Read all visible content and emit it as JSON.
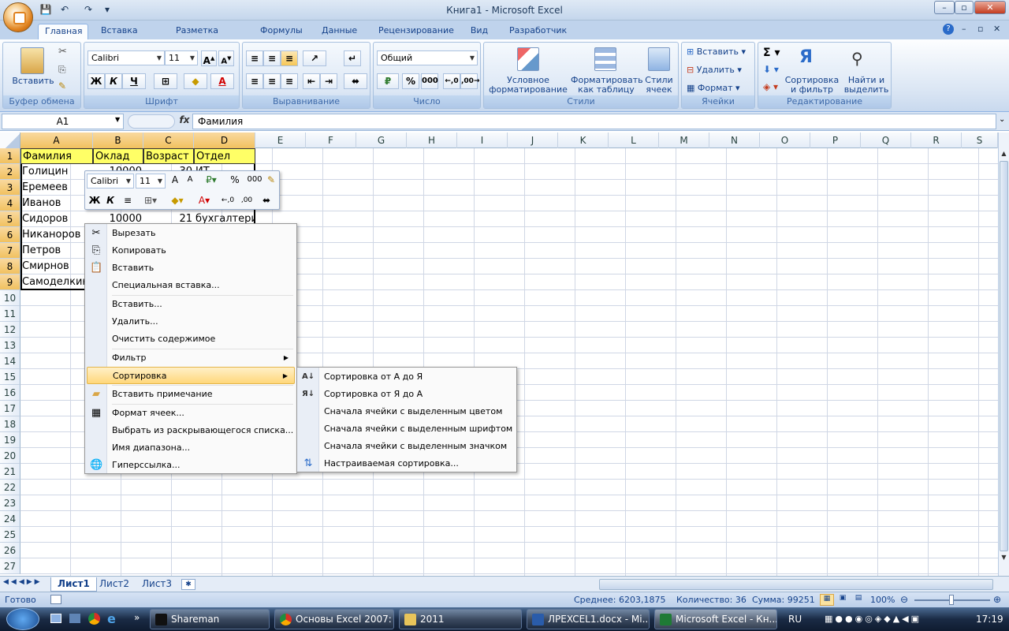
{
  "window": {
    "title": "Книга1 - Microsoft Excel"
  },
  "ribbon": {
    "tabs": [
      "Главная",
      "Вставка",
      "Разметка страницы",
      "Формулы",
      "Данные",
      "Рецензирование",
      "Вид",
      "Разработчик"
    ],
    "groups": {
      "clipboard": "Буфер обмена",
      "font": "Шрифт",
      "alignment": "Выравнивание",
      "number": "Число",
      "styles": "Стили",
      "cells": "Ячейки",
      "editing": "Редактирование"
    },
    "paste": "Вставить",
    "font_name": "Calibri",
    "font_size": "11",
    "number_format": "Общий",
    "cond_format": [
      "Условное",
      "форматирование"
    ],
    "format_table": [
      "Форматировать",
      "как таблицу"
    ],
    "cell_styles": [
      "Стили",
      "ячеек"
    ],
    "insert": "Вставить",
    "delete": "Удалить",
    "format": "Формат",
    "sort_filter": [
      "Сортировка",
      "и фильтр"
    ],
    "find_select": [
      "Найти и",
      "выделить"
    ],
    "bold": "Ж",
    "italic": "К",
    "underline": "Ч",
    "percent": "%",
    "thousands": "000"
  },
  "formula": {
    "cell_ref": "A1",
    "fx": "fx",
    "content": "Фамилия"
  },
  "columns": [
    "A",
    "B",
    "C",
    "D",
    "E",
    "F",
    "G",
    "H",
    "I",
    "J",
    "K",
    "L",
    "M",
    "N",
    "O",
    "P",
    "Q",
    "R",
    "S"
  ],
  "rows": [
    "1",
    "2",
    "3",
    "4",
    "5",
    "6",
    "7",
    "8",
    "9",
    "10",
    "11",
    "12",
    "13",
    "14",
    "15",
    "16",
    "17",
    "18",
    "19",
    "20",
    "21",
    "22",
    "23",
    "24",
    "25",
    "26",
    "27"
  ],
  "table": {
    "headers": [
      "Фамилия",
      "Оклад",
      "Возраст",
      "Отдел"
    ],
    "names": [
      "Голицин",
      "Еремеев",
      "Иванов",
      "Сидоров",
      "Никаноров",
      "Петров",
      "Смирнов",
      "Самоделкин"
    ],
    "row5": {
      "salary": "10000",
      "age": "21",
      "dept": "бухгалтерия"
    },
    "row2": {
      "salary": "10000",
      "age": "30",
      "dept": "ИТ"
    }
  },
  "mini_toolbar": {
    "font": "Calibri",
    "size": "11",
    "bold": "Ж",
    "italic": "К",
    "percent": "%",
    "thousands": "000"
  },
  "context_menu": {
    "items": [
      "Вырезать",
      "Копировать",
      "Вставить",
      "Специальная вставка...",
      "Вставить...",
      "Удалить...",
      "Очистить содержимое",
      "Фильтр",
      "Сортировка",
      "Вставить примечание",
      "Формат ячеек...",
      "Выбрать из раскрывающегося списка...",
      "Имя диапазона...",
      "Гиперссылка..."
    ]
  },
  "sort_submenu": {
    "items": [
      "Сортировка от А до Я",
      "Сортировка от Я до А",
      "Сначала ячейки с выделенным цветом",
      "Сначала ячейки с выделенным шрифтом",
      "Сначала ячейки с выделенным значком",
      "Настраиваемая сортировка..."
    ]
  },
  "sheets": [
    "Лист1",
    "Лист2",
    "Лист3"
  ],
  "status": {
    "ready": "Готово",
    "average": "Среднее: 6203,1875",
    "count": "Количество: 36",
    "sum": "Сумма: 99251",
    "zoom": "100%"
  },
  "taskbar": {
    "items": [
      "Shareman",
      "Основы Excel 2007: ...",
      "2011",
      "ЛРEXCEL1.docx - Mi...",
      "Microsoft Excel - Кн..."
    ],
    "lang": "RU",
    "clock": "17:19"
  },
  "colors": {
    "header_fill": "#ffff66",
    "selection": "#f1c15f",
    "ribbon": "#dbe6f4"
  }
}
